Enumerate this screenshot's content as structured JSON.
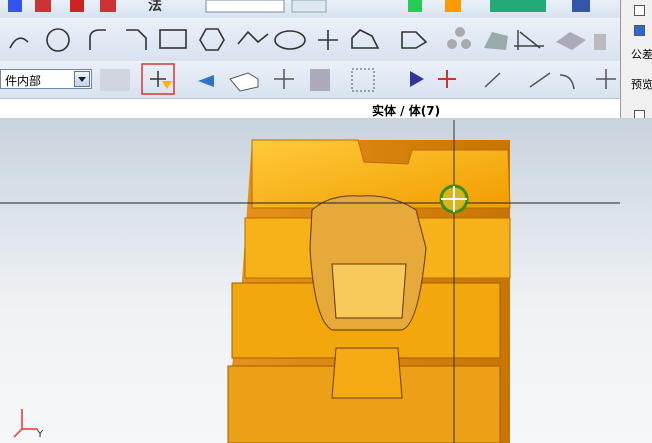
{
  "toolbar_top": {
    "icons": [
      "sketch-icon",
      "view-icon",
      "layer-icon",
      "constraint-icon",
      "model-icon",
      "wrench-icon",
      "drafting-icon",
      "analysis-icon",
      "simulation-icon"
    ]
  },
  "curve_toolbar": {
    "icons": [
      "arc-icon",
      "circle-icon",
      "fillet-icon",
      "chamfer-icon",
      "rectangle-icon",
      "polygon-icon",
      "spline-icon",
      "ellipse-icon",
      "point-icon",
      "offset-curve-icon",
      "project-curve-icon",
      "pattern-icon",
      "extract-icon",
      "section-icon",
      "trim-icon",
      "extrude-icon"
    ]
  },
  "selection_bar": {
    "filter_value": "件内部",
    "selection_label": "实体 / 体(7)"
  },
  "right_panel": {
    "labels": [
      "公差",
      "预览"
    ]
  },
  "colors": {
    "part": "#f5a912",
    "part_shadow": "#b86f00",
    "toolbar": "#dde6f1"
  }
}
